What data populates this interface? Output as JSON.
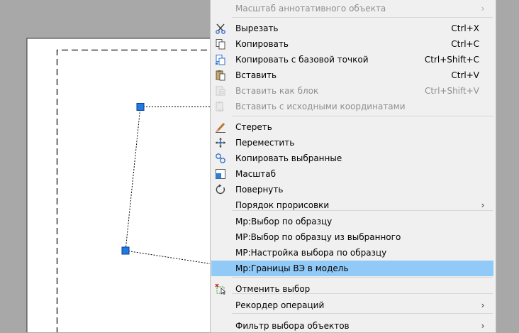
{
  "context_menu": {
    "items": [
      {
        "label": "Масштаб аннотативного объекта",
        "shortcut": "",
        "submenu": true,
        "disabled": true,
        "highlighted": false,
        "icon": ""
      },
      {
        "label": "Вырезать",
        "shortcut": "Ctrl+X",
        "submenu": false,
        "disabled": false,
        "highlighted": false,
        "icon": "scissors-icon"
      },
      {
        "label": "Копировать",
        "shortcut": "Ctrl+C",
        "submenu": false,
        "disabled": false,
        "highlighted": false,
        "icon": "copy-icon"
      },
      {
        "label": "Копировать с базовой точкой",
        "shortcut": "Ctrl+Shift+C",
        "submenu": false,
        "disabled": false,
        "highlighted": false,
        "icon": "copy-base-point-icon"
      },
      {
        "label": "Вставить",
        "shortcut": "Ctrl+V",
        "submenu": false,
        "disabled": false,
        "highlighted": false,
        "icon": "paste-icon"
      },
      {
        "label": "Вставить как блок",
        "shortcut": "Ctrl+Shift+V",
        "submenu": false,
        "disabled": true,
        "highlighted": false,
        "icon": "paste-as-block-icon"
      },
      {
        "label": "Вставить с исходными координатами",
        "shortcut": "",
        "submenu": false,
        "disabled": true,
        "highlighted": false,
        "icon": "paste-original-coords-icon"
      },
      {
        "label": "Стереть",
        "shortcut": "",
        "submenu": false,
        "disabled": false,
        "highlighted": false,
        "icon": "eraser-icon"
      },
      {
        "label": "Переместить",
        "shortcut": "",
        "submenu": false,
        "disabled": false,
        "highlighted": false,
        "icon": "move-icon"
      },
      {
        "label": "Копировать выбранные",
        "shortcut": "",
        "submenu": false,
        "disabled": false,
        "highlighted": false,
        "icon": "copy-selection-icon"
      },
      {
        "label": "Масштаб",
        "shortcut": "",
        "submenu": false,
        "disabled": false,
        "highlighted": false,
        "icon": "scale-icon"
      },
      {
        "label": "Повернуть",
        "shortcut": "",
        "submenu": false,
        "disabled": false,
        "highlighted": false,
        "icon": "rotate-icon"
      },
      {
        "label": "Порядок прорисовки",
        "shortcut": "",
        "submenu": true,
        "disabled": false,
        "highlighted": false,
        "icon": ""
      },
      {
        "label": "Мр:Выбор по образцу",
        "shortcut": "",
        "submenu": false,
        "disabled": false,
        "highlighted": false,
        "icon": ""
      },
      {
        "label": "МР:Выбор по образцу из выбранного",
        "shortcut": "",
        "submenu": false,
        "disabled": false,
        "highlighted": false,
        "icon": ""
      },
      {
        "label": "МР:Настройка выбора по образцу",
        "shortcut": "",
        "submenu": false,
        "disabled": false,
        "highlighted": false,
        "icon": ""
      },
      {
        "label": "Мр:Границы ВЭ в модель",
        "shortcut": "",
        "submenu": false,
        "disabled": false,
        "highlighted": true,
        "icon": ""
      },
      {
        "label": "Отменить выбор",
        "shortcut": "",
        "submenu": false,
        "disabled": false,
        "highlighted": false,
        "icon": "deselect-icon"
      },
      {
        "label": "Рекордер операций",
        "shortcut": "",
        "submenu": true,
        "disabled": false,
        "highlighted": false,
        "icon": ""
      },
      {
        "label": "Фильтр выбора объектов",
        "shortcut": "",
        "submenu": true,
        "disabled": false,
        "highlighted": false,
        "icon": ""
      }
    ]
  },
  "colors": {
    "background": "#a8a8a8",
    "paper": "#ffffff",
    "menu_bg": "#f0f0f0",
    "highlight": "#91c9f7",
    "grip": "#1e7be6"
  }
}
